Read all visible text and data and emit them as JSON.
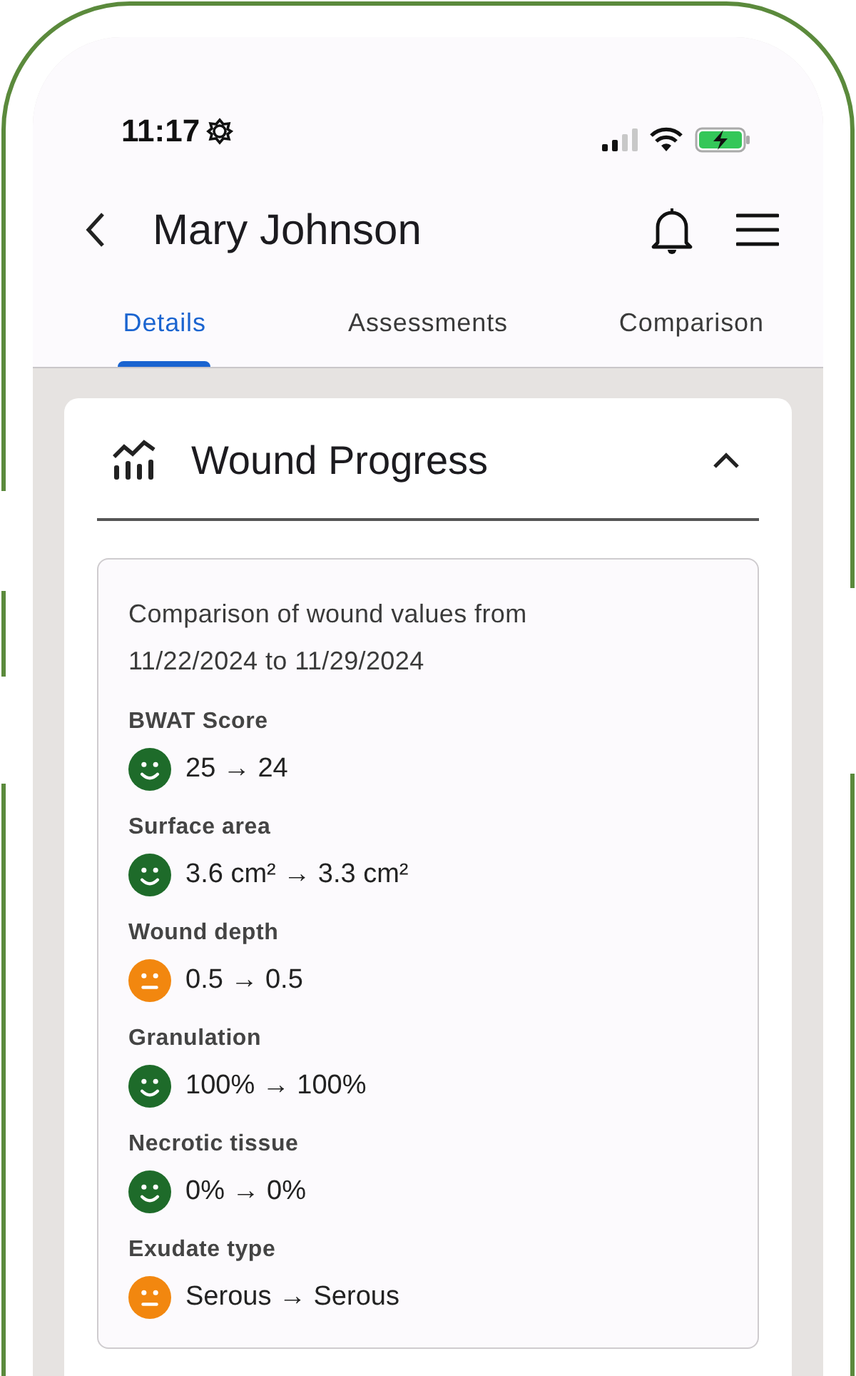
{
  "status_bar": {
    "time": "11:17"
  },
  "header": {
    "title": "Mary Johnson"
  },
  "tabs": [
    {
      "label": "Details",
      "selected": true
    },
    {
      "label": "Assessments",
      "selected": false
    },
    {
      "label": "Comparison",
      "selected": false
    }
  ],
  "card": {
    "title": "Wound Progress",
    "expanded": true,
    "summary": "Comparison of wound values from 11/22/2024 to 11/29/2024",
    "metrics": [
      {
        "label": "BWAT Score",
        "value": "25 → 24",
        "kind": "smile",
        "color": "#1e6b2a"
      },
      {
        "label": "Surface area",
        "value": "3.6 cm² → 3.3 cm²",
        "kind": "smile",
        "color": "#1e6b2a"
      },
      {
        "label": "Wound depth",
        "value": "0.5 → 0.5",
        "kind": "neutral",
        "color": "#f2870f"
      },
      {
        "label": "Granulation",
        "value": "100% → 100%",
        "kind": "smile",
        "color": "#1e6b2a"
      },
      {
        "label": "Necrotic tissue",
        "value": "0% → 0%",
        "kind": "smile",
        "color": "#1e6b2a"
      },
      {
        "label": "Exudate type",
        "value": "Serous → Serous",
        "kind": "neutral",
        "color": "#f2870f"
      }
    ]
  }
}
